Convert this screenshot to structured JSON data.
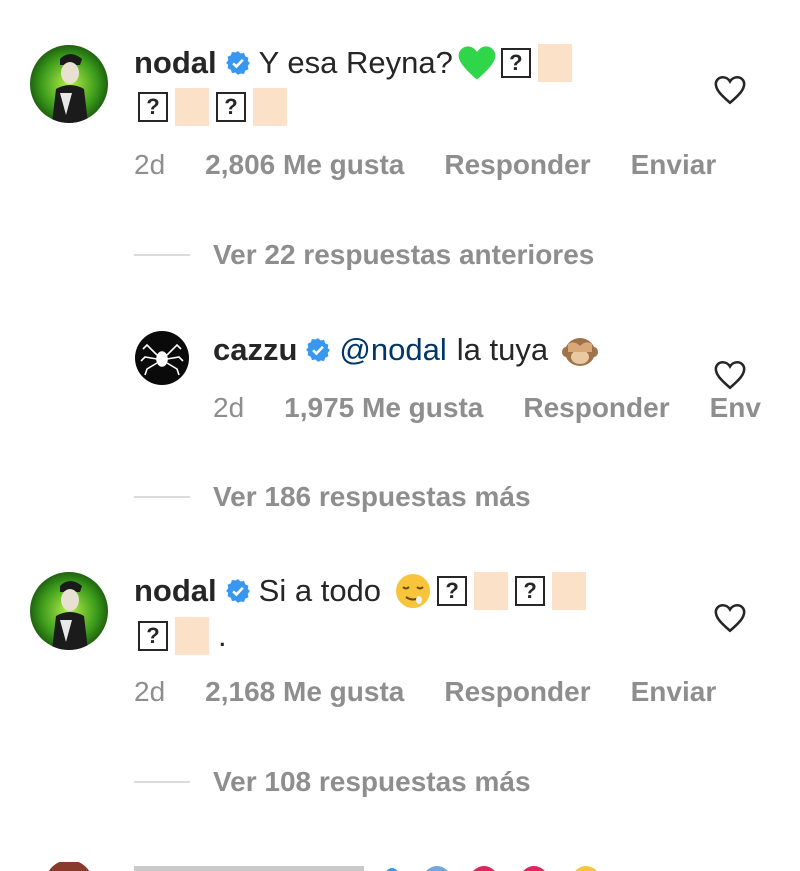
{
  "comments": [
    {
      "username": "nodal",
      "text": "Y esa Reyna?",
      "age": "2d",
      "likes": "2,806 Me gusta",
      "reply": "Responder",
      "send": "Enviar",
      "view_more": "Ver 22 respuestas anteriores"
    },
    {
      "username": "cazzu",
      "mention": "@nodal",
      "text": "la tuya",
      "age": "2d",
      "likes": "1,975 Me gusta",
      "reply": "Responder",
      "send": "Env",
      "view_more": "Ver 186 respuestas más"
    },
    {
      "username": "nodal",
      "text": "Si a todo",
      "trailing": ".",
      "age": "2d",
      "likes": "2,168 Me gusta",
      "reply": "Responder",
      "send": "Enviar",
      "view_more": "Ver 108 respuestas más"
    }
  ],
  "colors": {
    "verified": "#3897f0",
    "green_heart": "#2fd64a",
    "meta_gray": "#8e8e8e",
    "mention_blue": "#00376b"
  }
}
